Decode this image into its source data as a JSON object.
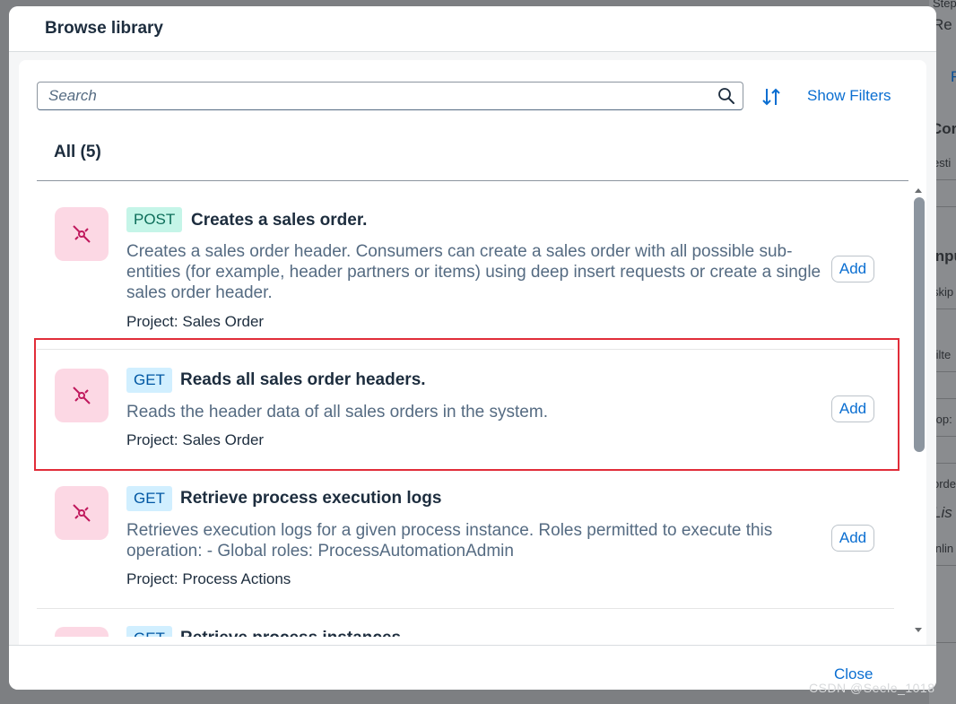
{
  "background_app": {
    "fragments": [
      "Step",
      "Re",
      "F",
      "Cor",
      "esti",
      "Inpu",
      "skip",
      "filte",
      "top:",
      "orde",
      "Lis",
      "inlin"
    ]
  },
  "dialog": {
    "title": "Browse library",
    "search": {
      "placeholder": "Search",
      "value": ""
    },
    "show_filters_label": "Show Filters",
    "count_label": "All (5)",
    "items": [
      {
        "method": "POST",
        "title": "Creates a sales order.",
        "description": "Creates a sales order header. Consumers can create a sales order with all possible sub-entities (for example, header partners or items) using deep insert requests or create a single sales order header.",
        "project": "Project: Sales Order",
        "add_label": "Add"
      },
      {
        "method": "GET",
        "title": "Reads all sales order headers.",
        "description": "Reads the header data of all sales orders in the system.",
        "project": "Project: Sales Order",
        "add_label": "Add"
      },
      {
        "method": "GET",
        "title": "Retrieve process execution logs",
        "description": "Retrieves execution logs for a given process instance. Roles permitted to execute this operation: - Global roles: ProcessAutomationAdmin",
        "project": "Project: Process Actions",
        "add_label": "Add"
      },
      {
        "method": "GET",
        "title": "Retrieve process instances",
        "description": "",
        "project": "",
        "add_label": ""
      }
    ],
    "close_label": "Close"
  },
  "watermark": "CSDN @Seele_1018",
  "colors": {
    "accent": "#0a6ed1",
    "post_badge_bg": "#c5f5e8",
    "get_badge_bg": "#d1efff",
    "icon_tile_bg": "#fcd8e4",
    "highlight_border": "#e12d39"
  },
  "icons": {
    "search": "search-icon",
    "sort": "sort-icon",
    "api": "api-link-icon"
  }
}
